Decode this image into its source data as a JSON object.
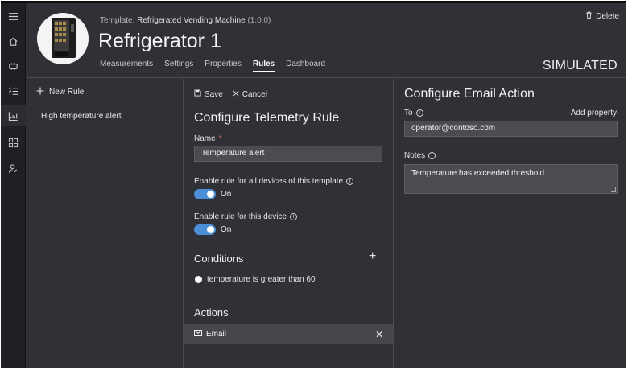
{
  "header": {
    "template_prefix": "Template:",
    "template_name": "Refrigerated Vending Machine",
    "template_version": "(1.0.0)",
    "device_name": "Refrigerator 1",
    "status": "SIMULATED",
    "delete_label": "Delete",
    "tabs": [
      {
        "label": "Measurements"
      },
      {
        "label": "Settings"
      },
      {
        "label": "Properties"
      },
      {
        "label": "Rules",
        "active": true
      },
      {
        "label": "Dashboard"
      }
    ]
  },
  "nav": {
    "icons": [
      "menu-icon",
      "home-icon",
      "device-icon",
      "checklist-icon",
      "analytics-icon",
      "apps-icon",
      "admin-icon"
    ]
  },
  "rules_list": {
    "new_rule_label": "New Rule",
    "items": [
      {
        "label": "High temperature alert"
      }
    ]
  },
  "telemetry_rule": {
    "save_label": "Save",
    "cancel_label": "Cancel",
    "title": "Configure Telemetry Rule",
    "name_label": "Name",
    "name_value": "Temperature alert",
    "enable_all_label": "Enable rule for all devices of this template",
    "enable_all_state": "On",
    "enable_device_label": "Enable rule for this device",
    "enable_device_state": "On",
    "conditions_title": "Conditions",
    "condition_text": "temperature is greater than 60",
    "actions_title": "Actions",
    "action_label": "Email"
  },
  "email_action": {
    "title": "Configure Email Action",
    "to_label": "To",
    "add_property_label": "Add property",
    "to_value": "operator@contoso.com",
    "notes_label": "Notes",
    "notes_value": "Temperature has exceeded threshold"
  },
  "colors": {
    "background": "#2f3136",
    "rail": "#1f2023",
    "input": "#4a4c51",
    "toggle_on": "#4d8fd6",
    "selected_row": "#45474c"
  }
}
